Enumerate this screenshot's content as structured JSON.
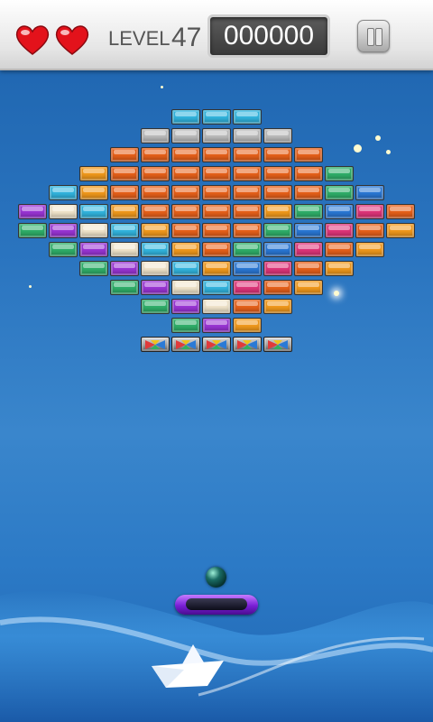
{
  "hud": {
    "lives": 2,
    "level_label": "LEVEL",
    "level_value": "47",
    "score": "000000"
  },
  "bricks": [
    {
      "row": 0,
      "col": 5,
      "color": "#32b6e0"
    },
    {
      "row": 0,
      "col": 6,
      "color": "#32b6e0"
    },
    {
      "row": 0,
      "col": 7,
      "color": "#32b6e0"
    },
    {
      "row": 1,
      "col": 4,
      "color": "#bdbdbd"
    },
    {
      "row": 1,
      "col": 5,
      "color": "#bdbdbd"
    },
    {
      "row": 1,
      "col": 6,
      "color": "#bdbdbd"
    },
    {
      "row": 1,
      "col": 7,
      "color": "#bdbdbd"
    },
    {
      "row": 1,
      "col": 8,
      "color": "#bdbdbd"
    },
    {
      "row": 2,
      "col": 3,
      "color": "#e8611a"
    },
    {
      "row": 2,
      "col": 4,
      "color": "#e8611a"
    },
    {
      "row": 2,
      "col": 5,
      "color": "#e8611a"
    },
    {
      "row": 2,
      "col": 6,
      "color": "#e8611a"
    },
    {
      "row": 2,
      "col": 7,
      "color": "#e8611a"
    },
    {
      "row": 2,
      "col": 8,
      "color": "#e8611a"
    },
    {
      "row": 2,
      "col": 9,
      "color": "#e8611a"
    },
    {
      "row": 3,
      "col": 2,
      "color": "#f39a1c"
    },
    {
      "row": 3,
      "col": 3,
      "color": "#e8611a"
    },
    {
      "row": 3,
      "col": 4,
      "color": "#e8611a"
    },
    {
      "row": 3,
      "col": 5,
      "color": "#e8611a"
    },
    {
      "row": 3,
      "col": 6,
      "color": "#e8611a"
    },
    {
      "row": 3,
      "col": 7,
      "color": "#e8611a"
    },
    {
      "row": 3,
      "col": 8,
      "color": "#e8611a"
    },
    {
      "row": 3,
      "col": 9,
      "color": "#e8611a"
    },
    {
      "row": 3,
      "col": 10,
      "color": "#2fb06a"
    },
    {
      "row": 4,
      "col": 1,
      "color": "#32b6e0"
    },
    {
      "row": 4,
      "col": 2,
      "color": "#f39a1c"
    },
    {
      "row": 4,
      "col": 3,
      "color": "#e8611a"
    },
    {
      "row": 4,
      "col": 4,
      "color": "#e8611a"
    },
    {
      "row": 4,
      "col": 5,
      "color": "#e8611a"
    },
    {
      "row": 4,
      "col": 6,
      "color": "#e8611a"
    },
    {
      "row": 4,
      "col": 7,
      "color": "#e8611a"
    },
    {
      "row": 4,
      "col": 8,
      "color": "#e8611a"
    },
    {
      "row": 4,
      "col": 9,
      "color": "#e8611a"
    },
    {
      "row": 4,
      "col": 10,
      "color": "#2fb06a"
    },
    {
      "row": 4,
      "col": 11,
      "color": "#2a78d6"
    },
    {
      "row": 5,
      "col": 0,
      "color": "#9b35d6"
    },
    {
      "row": 5,
      "col": 1,
      "color": "#f2e6cc"
    },
    {
      "row": 5,
      "col": 2,
      "color": "#32b6e0"
    },
    {
      "row": 5,
      "col": 3,
      "color": "#f39a1c"
    },
    {
      "row": 5,
      "col": 4,
      "color": "#e8611a"
    },
    {
      "row": 5,
      "col": 5,
      "color": "#e8611a"
    },
    {
      "row": 5,
      "col": 6,
      "color": "#e8611a"
    },
    {
      "row": 5,
      "col": 7,
      "color": "#e8611a"
    },
    {
      "row": 5,
      "col": 8,
      "color": "#f39a1c"
    },
    {
      "row": 5,
      "col": 9,
      "color": "#2fb06a"
    },
    {
      "row": 5,
      "col": 10,
      "color": "#2a78d6"
    },
    {
      "row": 5,
      "col": 11,
      "color": "#e0357a"
    },
    {
      "row": 5,
      "col": 12,
      "color": "#e8611a"
    },
    {
      "row": 6,
      "col": 0,
      "color": "#2fb06a"
    },
    {
      "row": 6,
      "col": 1,
      "color": "#9b35d6"
    },
    {
      "row": 6,
      "col": 2,
      "color": "#f2e6cc"
    },
    {
      "row": 6,
      "col": 3,
      "color": "#32b6e0"
    },
    {
      "row": 6,
      "col": 4,
      "color": "#f39a1c"
    },
    {
      "row": 6,
      "col": 5,
      "color": "#e8611a"
    },
    {
      "row": 6,
      "col": 6,
      "color": "#e8611a"
    },
    {
      "row": 6,
      "col": 7,
      "color": "#e8611a"
    },
    {
      "row": 6,
      "col": 8,
      "color": "#2fb06a"
    },
    {
      "row": 6,
      "col": 9,
      "color": "#2a78d6"
    },
    {
      "row": 6,
      "col": 10,
      "color": "#e0357a"
    },
    {
      "row": 6,
      "col": 11,
      "color": "#e8611a"
    },
    {
      "row": 6,
      "col": 12,
      "color": "#f39a1c"
    },
    {
      "row": 7,
      "col": 1,
      "color": "#2fb06a"
    },
    {
      "row": 7,
      "col": 2,
      "color": "#9b35d6"
    },
    {
      "row": 7,
      "col": 3,
      "color": "#f2e6cc"
    },
    {
      "row": 7,
      "col": 4,
      "color": "#32b6e0"
    },
    {
      "row": 7,
      "col": 5,
      "color": "#f39a1c"
    },
    {
      "row": 7,
      "col": 6,
      "color": "#e8611a"
    },
    {
      "row": 7,
      "col": 7,
      "color": "#2fb06a"
    },
    {
      "row": 7,
      "col": 8,
      "color": "#2a78d6"
    },
    {
      "row": 7,
      "col": 9,
      "color": "#e0357a"
    },
    {
      "row": 7,
      "col": 10,
      "color": "#e8611a"
    },
    {
      "row": 7,
      "col": 11,
      "color": "#f39a1c"
    },
    {
      "row": 8,
      "col": 2,
      "color": "#2fb06a"
    },
    {
      "row": 8,
      "col": 3,
      "color": "#9b35d6"
    },
    {
      "row": 8,
      "col": 4,
      "color": "#f2e6cc"
    },
    {
      "row": 8,
      "col": 5,
      "color": "#32b6e0"
    },
    {
      "row": 8,
      "col": 6,
      "color": "#f39a1c"
    },
    {
      "row": 8,
      "col": 7,
      "color": "#2a78d6"
    },
    {
      "row": 8,
      "col": 8,
      "color": "#e0357a"
    },
    {
      "row": 8,
      "col": 9,
      "color": "#e8611a"
    },
    {
      "row": 8,
      "col": 10,
      "color": "#f39a1c"
    },
    {
      "row": 9,
      "col": 3,
      "color": "#2fb06a"
    },
    {
      "row": 9,
      "col": 4,
      "color": "#9b35d6"
    },
    {
      "row": 9,
      "col": 5,
      "color": "#f2e6cc"
    },
    {
      "row": 9,
      "col": 6,
      "color": "#32b6e0"
    },
    {
      "row": 9,
      "col": 7,
      "color": "#e0357a"
    },
    {
      "row": 9,
      "col": 8,
      "color": "#e8611a"
    },
    {
      "row": 9,
      "col": 9,
      "color": "#f39a1c"
    },
    {
      "row": 10,
      "col": 4,
      "color": "#2fb06a"
    },
    {
      "row": 10,
      "col": 5,
      "color": "#9b35d6"
    },
    {
      "row": 10,
      "col": 6,
      "color": "#f2e6cc"
    },
    {
      "row": 10,
      "col": 7,
      "color": "#e8611a"
    },
    {
      "row": 10,
      "col": 8,
      "color": "#f39a1c"
    },
    {
      "row": 11,
      "col": 5,
      "color": "#2fb06a"
    },
    {
      "row": 11,
      "col": 6,
      "color": "#9b35d6"
    },
    {
      "row": 11,
      "col": 7,
      "color": "#f39a1c"
    },
    {
      "row": 12,
      "col": 4,
      "color": "steel"
    },
    {
      "row": 12,
      "col": 5,
      "color": "steel"
    },
    {
      "row": 12,
      "col": 6,
      "color": "steel"
    },
    {
      "row": 12,
      "col": 7,
      "color": "steel"
    },
    {
      "row": 12,
      "col": 8,
      "color": "steel"
    }
  ]
}
